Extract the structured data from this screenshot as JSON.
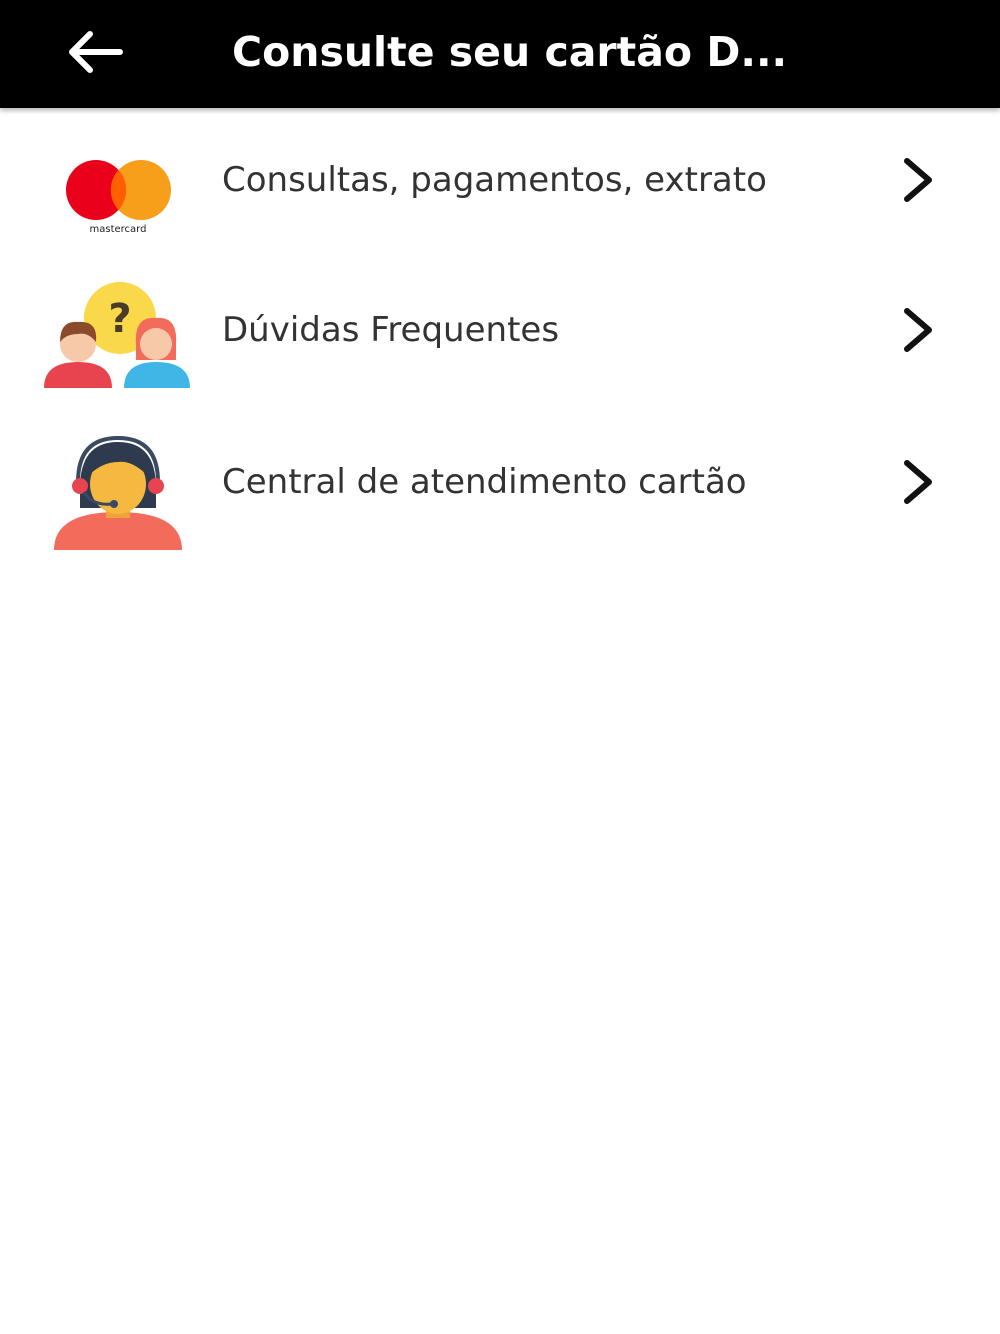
{
  "header": {
    "title": "Consulte seu cartão D...",
    "back_icon": "arrow-left-icon",
    "background": "#000000",
    "text_color": "#ffffff"
  },
  "menu": {
    "items": [
      {
        "label": "Consultas, pagamentos, extrato",
        "icon": "mastercard-logo",
        "logo_text": "mastercard",
        "chevron": "chevron-right-icon"
      },
      {
        "label": "Dúvidas Frequentes",
        "icon": "faq-people-icon",
        "chevron": "chevron-right-icon"
      },
      {
        "label": "Central de atendimento cartão",
        "icon": "support-agent-icon",
        "chevron": "chevron-right-icon"
      }
    ]
  },
  "colors": {
    "mastercard_red": "#EB001B",
    "mastercard_orange": "#F79E1B",
    "label_text": "#333333"
  }
}
